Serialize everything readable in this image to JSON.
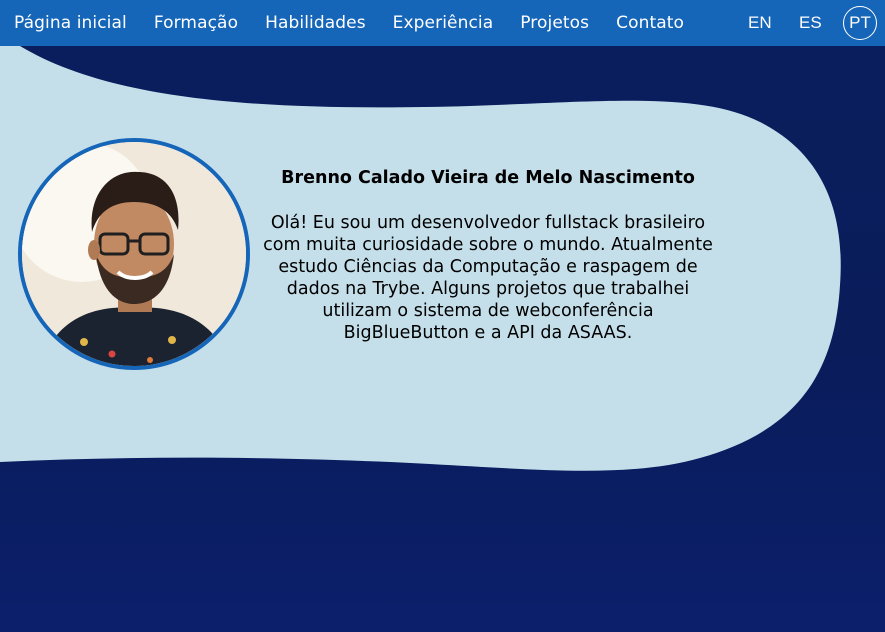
{
  "nav": {
    "items": [
      {
        "label": "Página inicial"
      },
      {
        "label": "Formação"
      },
      {
        "label": "Habilidades"
      },
      {
        "label": "Experiência"
      },
      {
        "label": "Projetos"
      },
      {
        "label": "Contato"
      }
    ]
  },
  "languages": {
    "en": "EN",
    "es": "ES",
    "pt": "PT",
    "selected": "PT"
  },
  "profile": {
    "name": "Brenno Calado Vieira de Melo Nascimento",
    "bio": "Olá! Eu sou um desenvolvedor fullstack brasileiro com muita curiosidade sobre o mundo. Atualmente estudo Ciências da Computação e raspagem de dados na Trybe. Alguns projetos que trabalhei utilizam o sistema de webconferência BigBlueButton e a API da ASAAS."
  },
  "colors": {
    "navbar": "#1565b8",
    "background": "#0a1f5e",
    "card": "#c5dfea",
    "accent_border": "#1565b8"
  }
}
